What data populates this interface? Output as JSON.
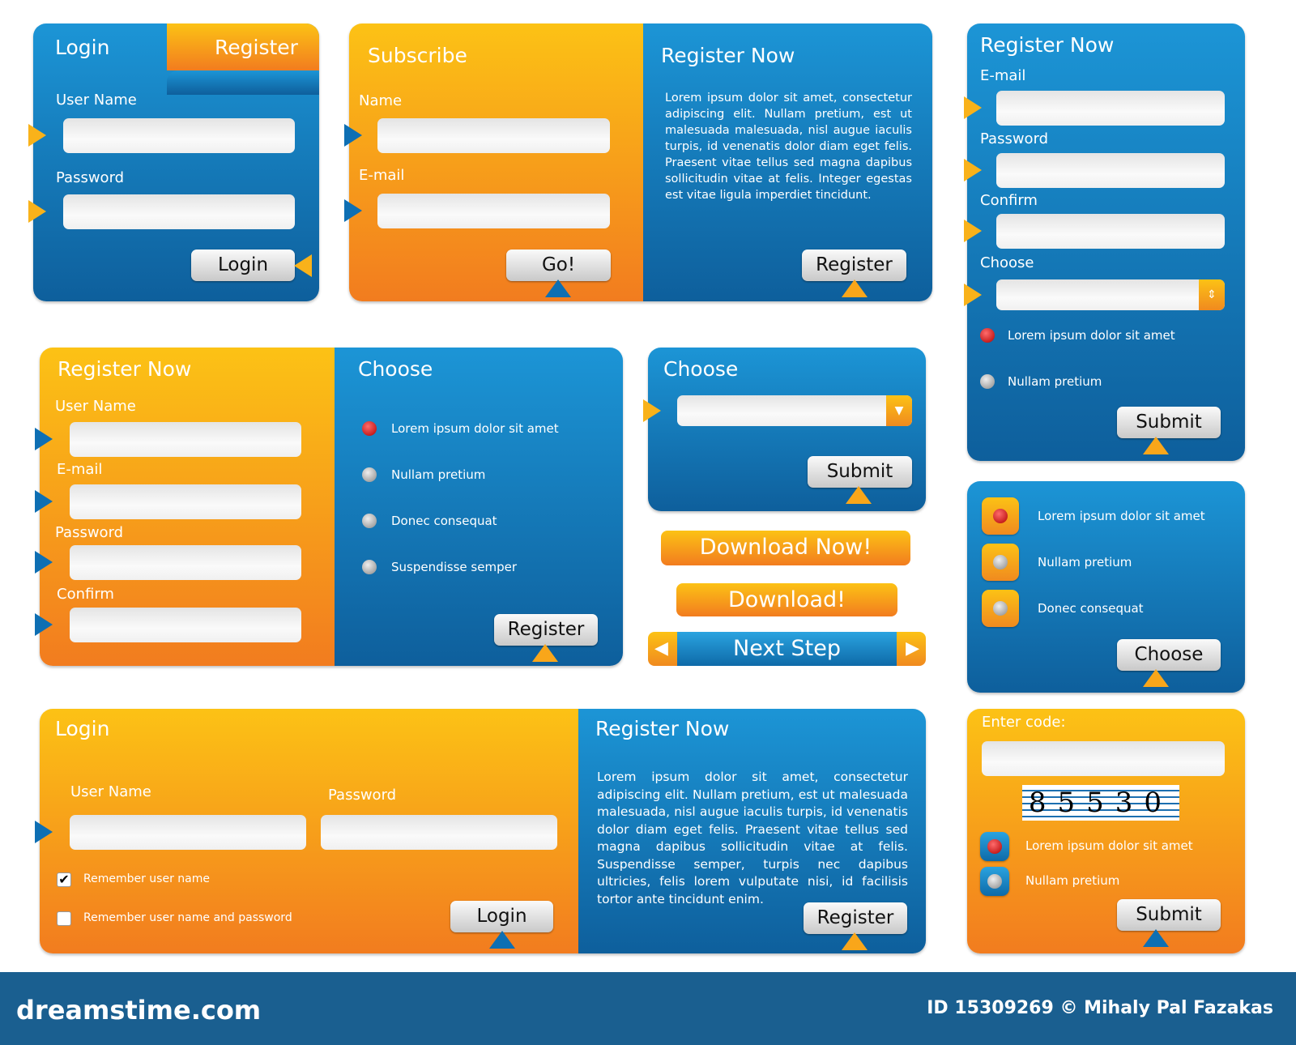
{
  "colors": {
    "blue": "#1c95d6",
    "orange": "#f9b21a",
    "footer": "#1a5f90"
  },
  "login_register": {
    "tab_login": "Login",
    "tab_register": "Register",
    "username_label": "User Name",
    "password_label": "Password",
    "login_button": "Login"
  },
  "subscribe": {
    "title": "Subscribe",
    "name_label": "Name",
    "email_label": "E-mail",
    "go_button": "Go!",
    "register_title": "Register Now",
    "register_text": "Lorem ipsum dolor sit amet, consectetur adipiscing elit. Nullam pretium, est ut malesuada malesuada, nisl augue iaculis turpis, id venenatis dolor diam eget felis. Praesent vitae tellus sed magna dapibus sollicitudin vitae at felis. Integer egestas est vitae ligula imperdiet tincidunt.",
    "register_button": "Register"
  },
  "register_right": {
    "title": "Register Now",
    "email_label": "E-mail",
    "password_label": "Password",
    "confirm_label": "Confirm",
    "choose_label": "Choose",
    "options": [
      "Lorem ipsum dolor sit amet",
      "Nullam pretium"
    ],
    "submit_button": "Submit"
  },
  "register_choose": {
    "title": "Register Now",
    "username_label": "User Name",
    "email_label": "E-mail",
    "password_label": "Password",
    "confirm_label": "Confirm",
    "choose_title": "Choose",
    "options": [
      "Lorem ipsum dolor sit amet",
      "Nullam pretium",
      "Donec consequat",
      "Suspendisse semper"
    ],
    "register_button": "Register"
  },
  "choose_box": {
    "title": "Choose",
    "submit_button": "Submit"
  },
  "buttons": {
    "download_now": "Download Now!",
    "download": "Download!",
    "next_step": "Next Step"
  },
  "radio_box": {
    "options": [
      "Lorem ipsum dolor sit amet",
      "Nullam pretium",
      "Donec consequat"
    ],
    "choose_button": "Choose"
  },
  "login_bottom": {
    "title": "Login",
    "username_label": "User Name",
    "password_label": "Password",
    "remember_user": "Remember user name",
    "remember_both": "Remember user name and password",
    "login_button": "Login",
    "register_title": "Register Now",
    "register_text": "Lorem ipsum dolor sit amet, consectetur adipiscing elit. Nullam pretium, est ut malesuada malesuada, nisl augue iaculis turpis, id venenatis dolor diam eget felis. Praesent vitae tellus sed magna dapibus sollicitudin vitae at felis. Suspendisse semper, turpis nec dapibus ultricies, felis lorem vulputate nisi, id facilisis tortor ante tincidunt enim.",
    "register_button": "Register"
  },
  "captcha": {
    "label": "Enter code:",
    "code": "85530",
    "options": [
      "Lorem ipsum dolor sit amet",
      "Nullam pretium"
    ],
    "submit_button": "Submit"
  },
  "footer": {
    "logo": "dreamstime.com",
    "credit": "ID 15309269 © Mihaly Pal Fazakas"
  }
}
